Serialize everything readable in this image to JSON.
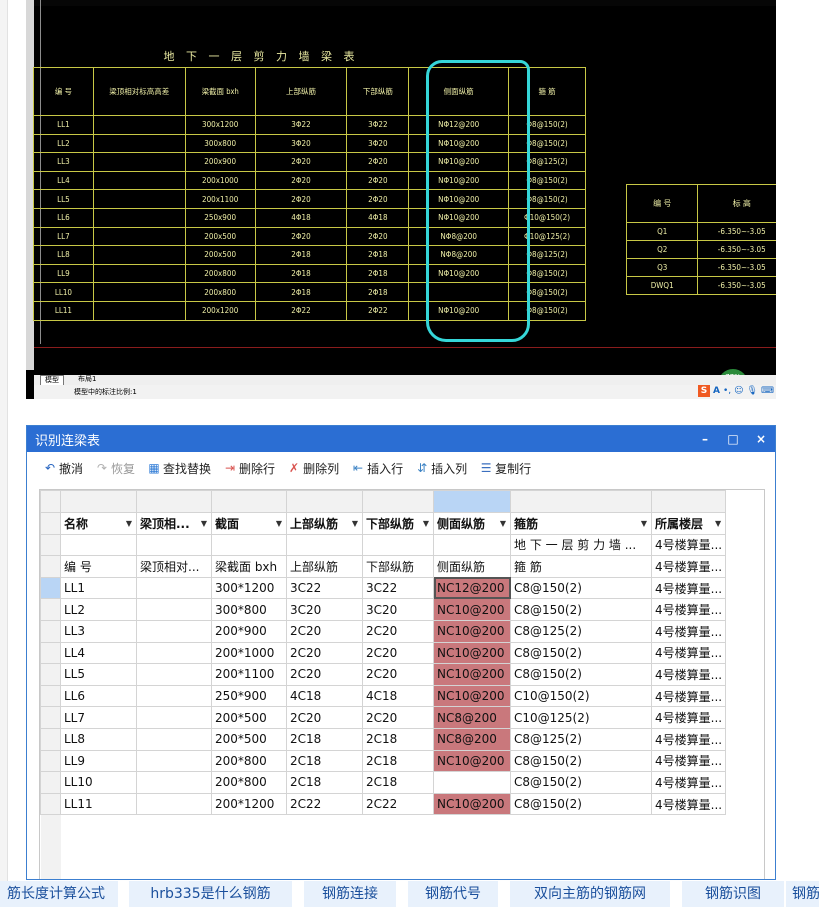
{
  "cad": {
    "drawing_title": "地 下 一 层 剪 力 墙 梁 表",
    "beam_table": {
      "headers": [
        "编 号",
        "梁顶相对标高高差",
        "梁截面 bxh",
        "上部纵筋",
        "下部纵筋",
        "侧面纵筋",
        "箍 筋"
      ],
      "rows": [
        [
          "LL1",
          "",
          "300x1200",
          "3Φ22",
          "3Φ22",
          "NΦ12@200",
          "Φ8@150(2)"
        ],
        [
          "LL2",
          "",
          "300x800",
          "3Φ20",
          "3Φ20",
          "NΦ10@200",
          "Φ8@150(2)"
        ],
        [
          "LL3",
          "",
          "200x900",
          "2Φ20",
          "2Φ20",
          "NΦ10@200",
          "Φ8@125(2)"
        ],
        [
          "LL4",
          "",
          "200x1000",
          "2Φ20",
          "2Φ20",
          "NΦ10@200",
          "Φ8@150(2)"
        ],
        [
          "LL5",
          "",
          "200x1100",
          "2Φ20",
          "2Φ20",
          "NΦ10@200",
          "Φ8@150(2)"
        ],
        [
          "LL6",
          "",
          "250x900",
          "4Φ18",
          "4Φ18",
          "NΦ10@200",
          "Φ10@150(2)"
        ],
        [
          "LL7",
          "",
          "200x500",
          "2Φ20",
          "2Φ20",
          "NΦ8@200",
          "Φ10@125(2)"
        ],
        [
          "LL8",
          "",
          "200x500",
          "2Φ18",
          "2Φ18",
          "NΦ8@200",
          "Φ8@125(2)"
        ],
        [
          "LL9",
          "",
          "200x800",
          "2Φ18",
          "2Φ18",
          "NΦ10@200",
          "Φ8@150(2)"
        ],
        [
          "LL10",
          "",
          "200x800",
          "2Φ18",
          "2Φ18",
          "",
          "Φ8@150(2)"
        ],
        [
          "LL11",
          "",
          "200x1200",
          "2Φ22",
          "2Φ22",
          "NΦ10@200",
          "Φ8@150(2)"
        ]
      ]
    },
    "elev_table": {
      "headers": [
        "编 号",
        "标 高"
      ],
      "rows": [
        [
          "Q1",
          "-6.350~-3.05"
        ],
        [
          "Q2",
          "-6.350~-3.05"
        ],
        [
          "Q3",
          "-6.350~-3.05"
        ],
        [
          "DWQ1",
          "-6.350~-3.05"
        ]
      ]
    },
    "tab_model": "模型",
    "tab_layout": "布局1",
    "status_text": "模型中的标注比例:1",
    "badge_text": "77%",
    "ime_text": "A",
    "highlight_color": "#35d6d8"
  },
  "dialog": {
    "title": "识别连梁表",
    "window_buttons": [
      "–",
      "□",
      "×"
    ],
    "toolbar": [
      {
        "label": "撤消",
        "icon": "undo-icon",
        "enabled": true
      },
      {
        "label": "恢复",
        "icon": "redo-icon",
        "enabled": false
      },
      {
        "label": "查找替换",
        "icon": "find-replace-icon",
        "enabled": true
      },
      {
        "label": "删除行",
        "icon": "delete-row-icon",
        "enabled": true
      },
      {
        "label": "删除列",
        "icon": "delete-column-icon",
        "enabled": true
      },
      {
        "label": "插入行",
        "icon": "insert-row-icon",
        "enabled": true
      },
      {
        "label": "插入列",
        "icon": "insert-column-icon",
        "enabled": true
      },
      {
        "label": "复制行",
        "icon": "copy-row-icon",
        "enabled": true
      }
    ],
    "grid": {
      "column_headers": [
        "名称",
        "梁顶相...",
        "截面",
        "上部纵筋",
        "下部纵筋",
        "侧面纵筋",
        "箍筋",
        "所属楼层"
      ],
      "subtitle_row": [
        "",
        "",
        "",
        "",
        "",
        "",
        "地 下 一 层 剪 力 墙 ...",
        "4号楼算量..."
      ],
      "header_row": [
        "编 号",
        "梁顶相对...",
        "梁截面 bxh",
        "上部纵筋",
        "下部纵筋",
        "侧面纵筋",
        "箍 筋",
        "4号楼算量..."
      ],
      "rows": [
        [
          "LL1",
          "",
          "300*1200",
          "3C22",
          "3C22",
          "NC12@200",
          "C8@150(2)",
          "4号楼算量..."
        ],
        [
          "LL2",
          "",
          "300*800",
          "3C20",
          "3C20",
          "NC10@200",
          "C8@150(2)",
          "4号楼算量..."
        ],
        [
          "LL3",
          "",
          "200*900",
          "2C20",
          "2C20",
          "NC10@200",
          "C8@125(2)",
          "4号楼算量..."
        ],
        [
          "LL4",
          "",
          "200*1000",
          "2C20",
          "2C20",
          "NC10@200",
          "C8@150(2)",
          "4号楼算量..."
        ],
        [
          "LL5",
          "",
          "200*1100",
          "2C20",
          "2C20",
          "NC10@200",
          "C8@150(2)",
          "4号楼算量..."
        ],
        [
          "LL6",
          "",
          "250*900",
          "4C18",
          "4C18",
          "NC10@200",
          "C10@150(2)",
          "4号楼算量..."
        ],
        [
          "LL7",
          "",
          "200*500",
          "2C20",
          "2C20",
          "NC8@200",
          "C10@125(2)",
          "4号楼算量..."
        ],
        [
          "LL8",
          "",
          "200*500",
          "2C18",
          "2C18",
          "NC8@200",
          "C8@125(2)",
          "4号楼算量..."
        ],
        [
          "LL9",
          "",
          "200*800",
          "2C18",
          "2C18",
          "NC10@200",
          "C8@150(2)",
          "4号楼算量..."
        ],
        [
          "LL10",
          "",
          "200*800",
          "2C18",
          "2C18",
          "",
          "C8@150(2)",
          "4号楼算量..."
        ],
        [
          "LL11",
          "",
          "200*1200",
          "2C22",
          "2C22",
          "NC10@200",
          "C8@150(2)",
          "4号楼算量..."
        ]
      ],
      "highlight_color": "#c9787c",
      "selected_column_color": "#b9d5f5"
    }
  },
  "tags": [
    "筋长度计算公式",
    "hrb335是什么钢筋",
    "钢筋连接",
    "钢筋代号",
    "双向主筋的钢筋网",
    "钢筋识图",
    "钢筋"
  ]
}
